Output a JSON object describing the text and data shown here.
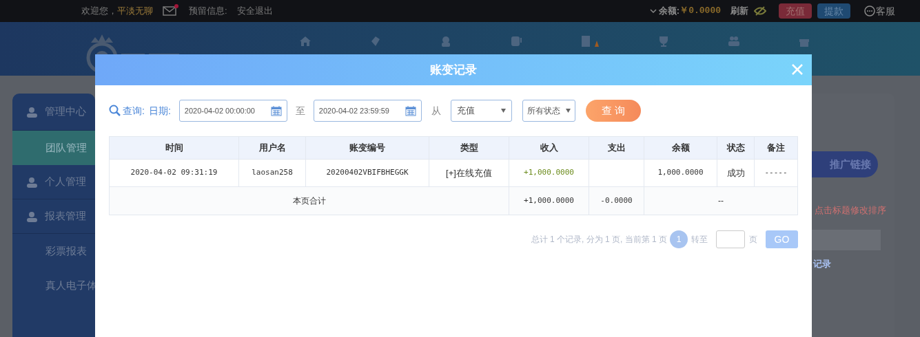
{
  "top_bar": {
    "welcome": "欢迎您，",
    "username": "平淡无聊",
    "has_unread": true,
    "reserved_info": "预留信息:",
    "logout": "安全退出",
    "balance_label": "余额:",
    "balance": "￥0.0000",
    "refresh": "刷新",
    "deposit": "充值",
    "withdraw": "提款",
    "support": "客服"
  },
  "sidebar": {
    "items": [
      {
        "label": "管理中心",
        "kind": "section",
        "selected": false
      },
      {
        "label": "团队管理",
        "kind": "sub",
        "selected": true
      },
      {
        "label": "个人管理",
        "kind": "section",
        "selected": false
      },
      {
        "label": "报表管理",
        "kind": "section",
        "selected": false
      },
      {
        "label": "彩票报表",
        "kind": "sub",
        "selected": false
      },
      {
        "label": "真人电子体",
        "kind": "sub",
        "selected": false
      }
    ]
  },
  "content": {
    "promo_button": "推广链接",
    "sort_hint": "点击标题修改排序",
    "records_link": "记录"
  },
  "dialog": {
    "title": "账变记录",
    "query": {
      "label": "查询:",
      "date_label": "日期:",
      "start": "2020-04-02 00:00:00",
      "to": "至",
      "end": "2020-04-02 23:59:59",
      "from": "从",
      "type": "充值",
      "status": "所有状态",
      "button": "查 询"
    },
    "table": {
      "columns": [
        "时间",
        "用户名",
        "账变编号",
        "类型",
        "收入",
        "支出",
        "余额",
        "状态",
        "备注"
      ],
      "rows": [
        [
          "2020-04-02 09:31:19",
          "laosan258",
          "20200402VBIFBHEGGK",
          "[+]在线充值",
          "+1,000.0000",
          "",
          "1,000.0000",
          "成功",
          "-----"
        ]
      ],
      "total": {
        "label": "本页合计",
        "income": "+1,000.0000",
        "expense": "-0.0000",
        "rest": "--"
      }
    },
    "pagination": {
      "summary": "总计 1 个记录, 分为 1 页, 当前第 1 页",
      "pages": [
        {
          "label": "1",
          "selected": true
        }
      ],
      "goto": "转至",
      "page_unit": "页",
      "go": "GO"
    }
  }
}
